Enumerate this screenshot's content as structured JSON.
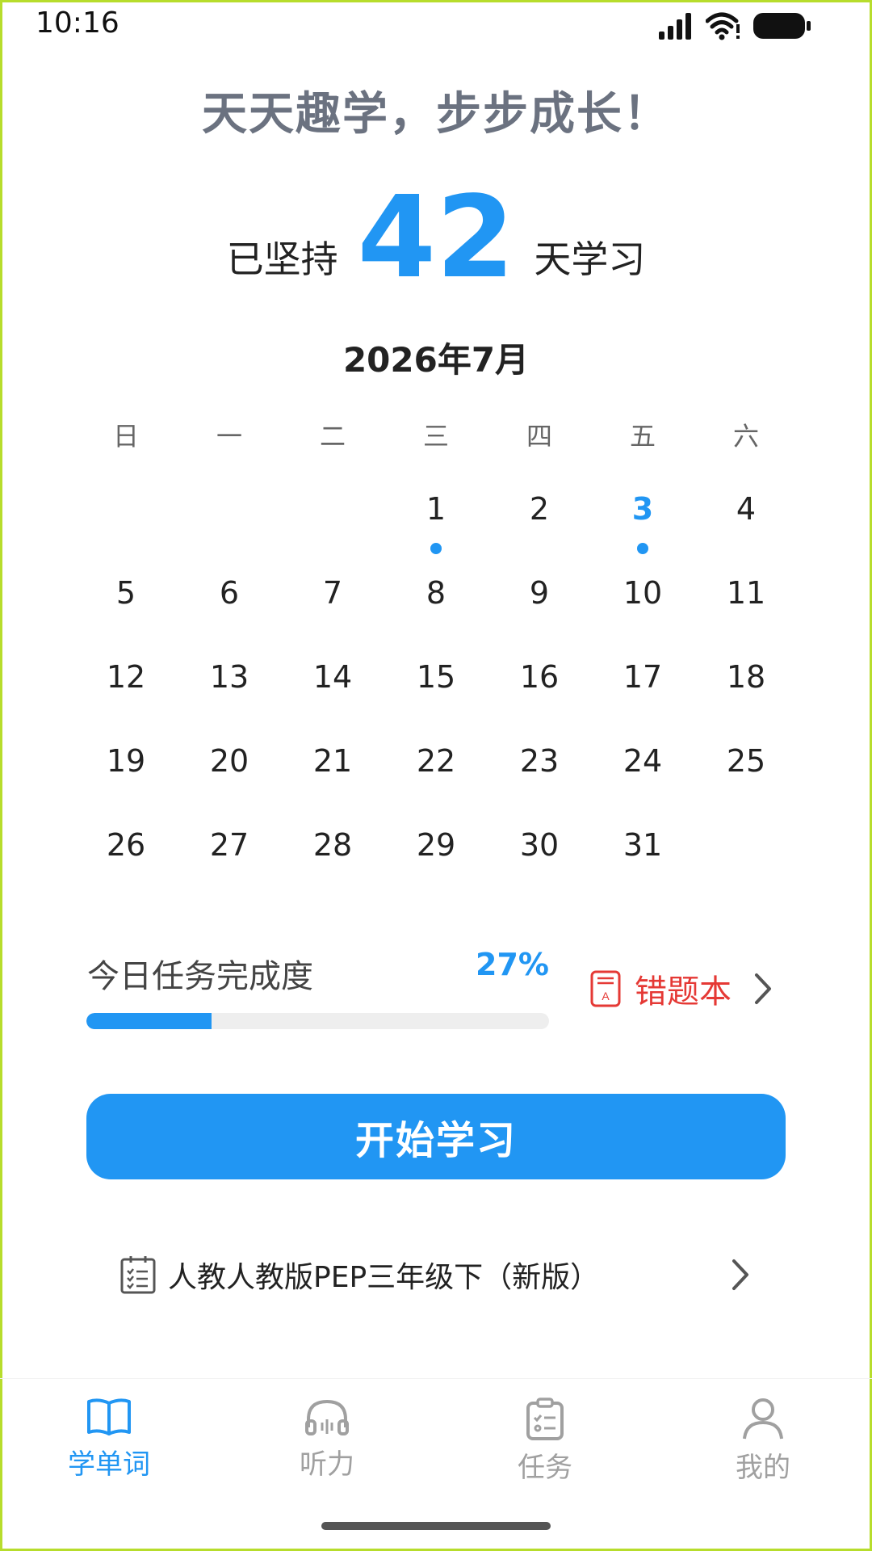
{
  "status_bar": {
    "time": "10:16"
  },
  "header": {
    "slogan": "天天趣学，步步成长！",
    "streak_prefix": "已坚持",
    "streak_days": "42",
    "streak_suffix": "天学习"
  },
  "calendar": {
    "month_title": "2026年7月",
    "weekdays": [
      "日",
      "一",
      "二",
      "三",
      "四",
      "五",
      "六"
    ],
    "first_weekday_index": 3,
    "days": [
      "1",
      "2",
      "3",
      "4",
      "5",
      "6",
      "7",
      "8",
      "9",
      "10",
      "11",
      "12",
      "13",
      "14",
      "15",
      "16",
      "17",
      "18",
      "19",
      "20",
      "21",
      "22",
      "23",
      "24",
      "25",
      "26",
      "27",
      "28",
      "29",
      "30",
      "31"
    ],
    "today": "3",
    "studied_days": [
      "1",
      "3"
    ],
    "accent_color": "#2196f3"
  },
  "progress": {
    "label": "今日任务完成度",
    "percent_text": "27%",
    "value": 0.27
  },
  "mistake_book": {
    "label": "错题本",
    "icon": "notebook-a-icon"
  },
  "start_button": {
    "label": "开始学习"
  },
  "textbook": {
    "label": "人教人教版PEP三年级下（新版）",
    "icon": "checklist-icon"
  },
  "bottom_nav": {
    "items": [
      {
        "label": "学单词",
        "icon": "book-open-icon",
        "active": true
      },
      {
        "label": "听力",
        "icon": "headphones-icon",
        "active": false
      },
      {
        "label": "任务",
        "icon": "clipboard-icon",
        "active": false
      },
      {
        "label": "我的",
        "icon": "user-icon",
        "active": false
      }
    ]
  }
}
